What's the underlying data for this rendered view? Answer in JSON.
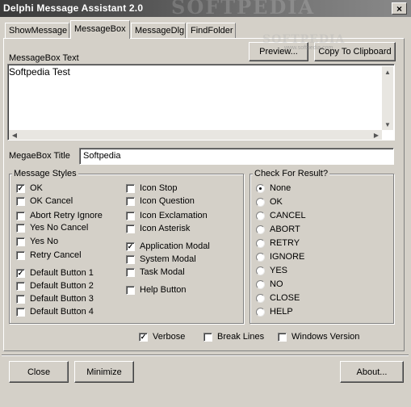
{
  "window": {
    "title": "Delphi Message Assistant 2.0",
    "close_glyph": "×",
    "watermark": "SOFTPEDIA",
    "watermark_url": "www.softpedia.com"
  },
  "tabs": [
    {
      "label": "ShowMessage"
    },
    {
      "label": "MessageBox"
    },
    {
      "label": "MessageDlg"
    },
    {
      "label": "FindFolder"
    }
  ],
  "active_tab": "MessageBox",
  "messagebox": {
    "text_label": "MessageBox Text",
    "preview_label": "Preview...",
    "copy_label": "Copy To Clipboard",
    "text_value": "Softpedia Test",
    "title_label": "MegaeBox Title",
    "title_value": "Softpedia"
  },
  "styles_group": {
    "title": "Message Styles",
    "col1": [
      {
        "label": "OK",
        "checked": true
      },
      {
        "label": "OK Cancel",
        "checked": false
      },
      {
        "label": "Abort Retry Ignore",
        "checked": false
      },
      {
        "label": "Yes No Cancel",
        "checked": false
      },
      {
        "label": "Yes No",
        "checked": false
      },
      {
        "label": "Retry Cancel",
        "checked": false
      },
      {
        "label": "Default Button 1",
        "checked": true
      },
      {
        "label": "Default Button 2",
        "checked": false
      },
      {
        "label": "Default Button 3",
        "checked": false
      },
      {
        "label": "Default Button 4",
        "checked": false
      }
    ],
    "col2": [
      {
        "label": "Icon Stop",
        "checked": false
      },
      {
        "label": "Icon Question",
        "checked": false
      },
      {
        "label": "Icon Exclamation",
        "checked": false
      },
      {
        "label": "Icon Asterisk",
        "checked": false
      },
      {
        "label": "Application Modal",
        "checked": true
      },
      {
        "label": "System Modal",
        "checked": false
      },
      {
        "label": "Task Modal",
        "checked": false
      },
      {
        "label": "Help Button",
        "checked": false
      }
    ]
  },
  "result_group": {
    "title": "Check For Result?",
    "options": [
      "None",
      "OK",
      "CANCEL",
      "ABORT",
      "RETRY",
      "IGNORE",
      "YES",
      "NO",
      "CLOSE",
      "HELP"
    ],
    "selected": "None"
  },
  "bottom_options": [
    {
      "label": "Verbose",
      "checked": true
    },
    {
      "label": "Break Lines",
      "checked": false
    },
    {
      "label": "Windows Version",
      "checked": false
    }
  ],
  "footer": {
    "close_label": "Close",
    "minimize_label": "Minimize",
    "about_label": "About..."
  },
  "colors": {
    "face": "#d4d0c8",
    "title_bar_start": "#3a3a3a",
    "title_bar_end": "#8a8a8a"
  }
}
